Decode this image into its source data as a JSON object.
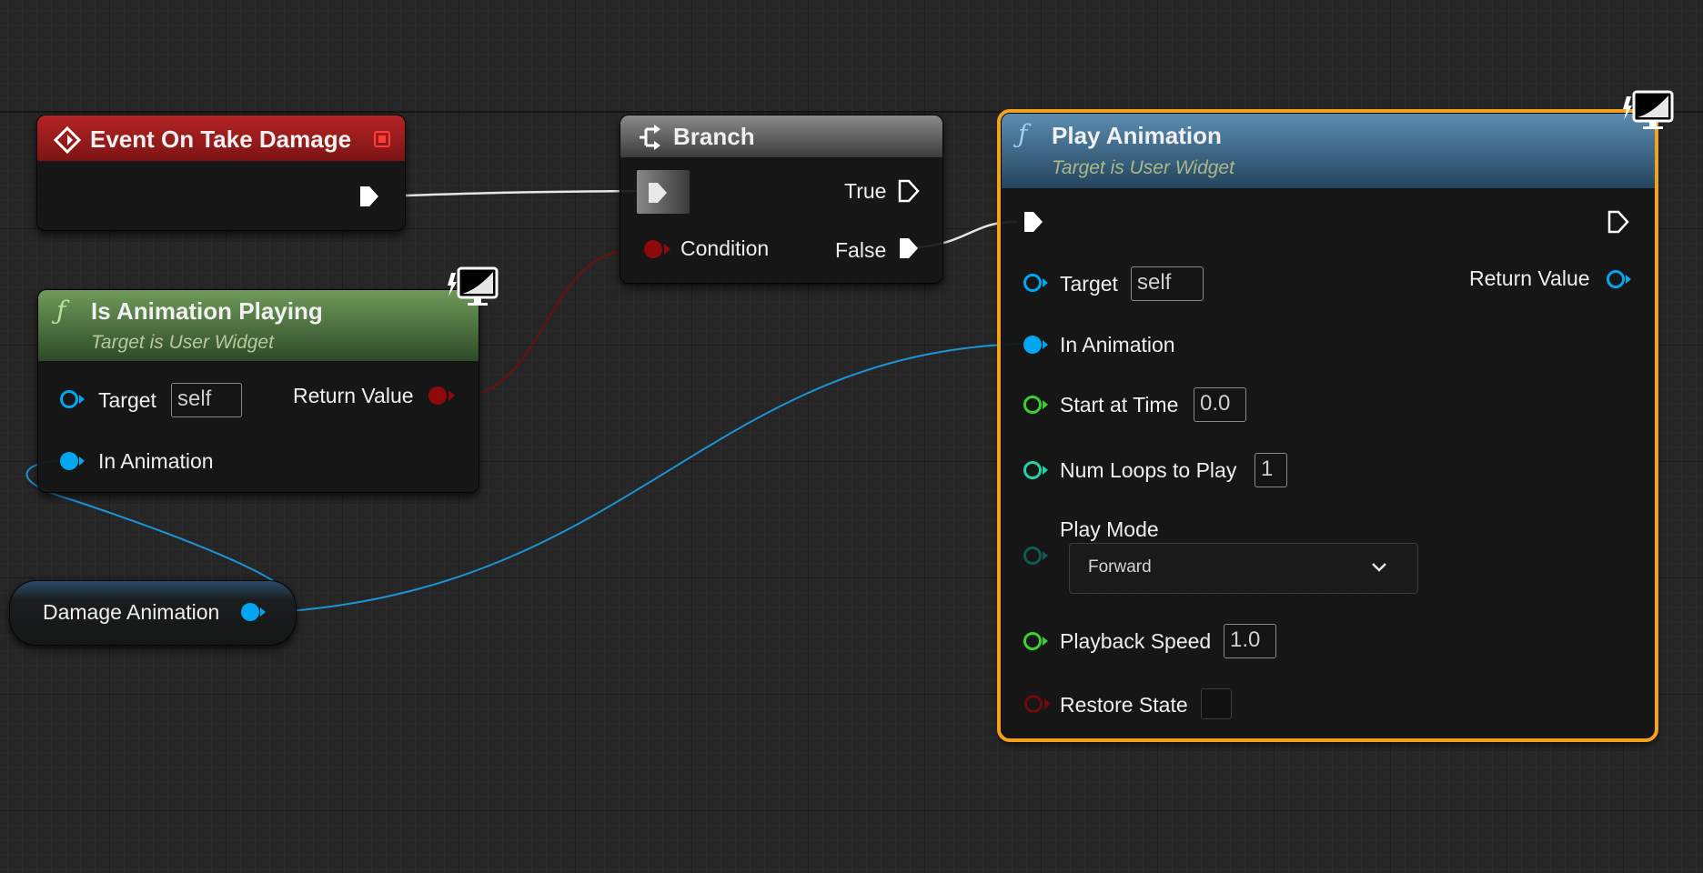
{
  "nodes": {
    "event": {
      "title": "Event On Take Damage"
    },
    "branch": {
      "title": "Branch",
      "true_label": "True",
      "false_label": "False",
      "condition_label": "Condition"
    },
    "is_playing": {
      "title": "Is Animation Playing",
      "subtitle": "Target is User Widget",
      "target_label": "Target",
      "target_value": "self",
      "return_label": "Return Value",
      "in_anim_label": "In Animation"
    },
    "variable": {
      "label": "Damage Animation"
    },
    "play": {
      "title": "Play Animation",
      "subtitle": "Target is User Widget",
      "target_label": "Target",
      "target_value": "self",
      "return_label": "Return Value",
      "in_anim_label": "In Animation",
      "start_label": "Start at Time",
      "start_value": "0.0",
      "loops_label": "Num Loops to Play",
      "loops_value": "1",
      "mode_label": "Play Mode",
      "mode_value": "Forward",
      "speed_label": "Playback Speed",
      "speed_value": "1.0",
      "restore_label": "Restore State",
      "restore_value": false
    }
  },
  "colors": {
    "exec": "#ffffff",
    "bool": "#8e0a0a",
    "object": "#00a7f0",
    "float": "#38d12e",
    "int": "#1fd6a8",
    "event_header": "#a11c1c",
    "function_header": "#4d7a9d",
    "pure_header": "#5b8a4a",
    "selection": "#f4a21a"
  },
  "icons": [
    "event-diamond-icon",
    "branch-icon",
    "function-icon",
    "widget-monitor-icon",
    "chevron-down-icon"
  ]
}
